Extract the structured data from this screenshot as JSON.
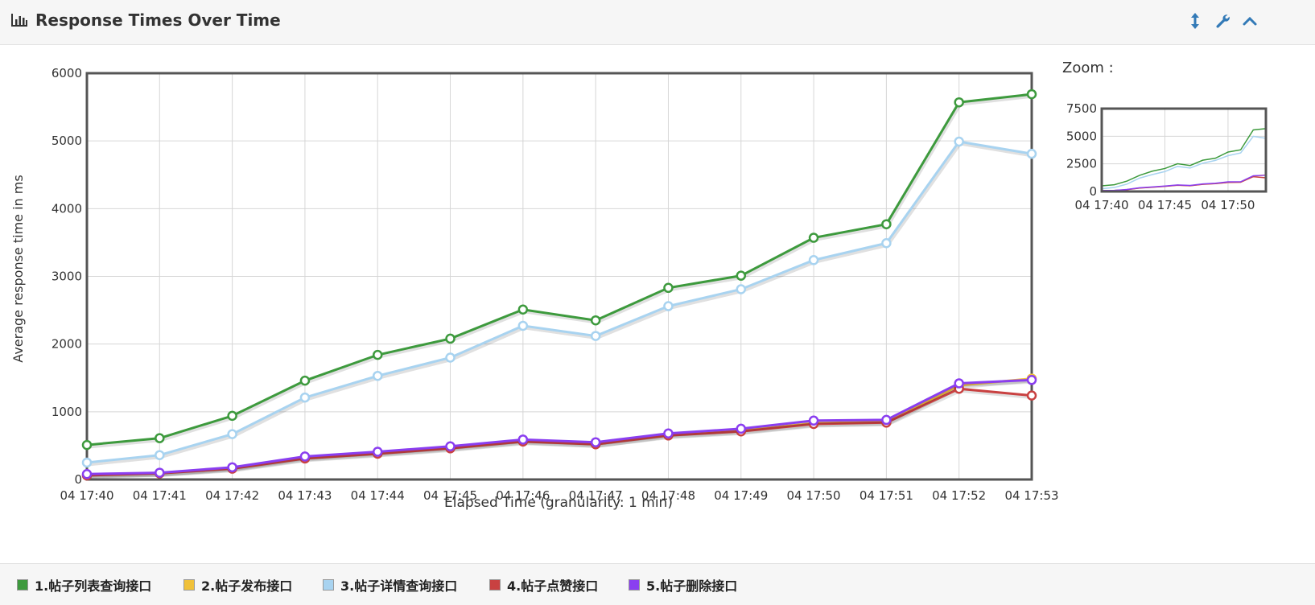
{
  "header": {
    "title": "Response Times Over Time",
    "icons": [
      "bar-chart-icon",
      "resize-vertical-icon",
      "wrench-icon",
      "chevron-up-icon"
    ],
    "accent_color": "#337ab7"
  },
  "zoom": {
    "label": "Zoom :"
  },
  "chart_data": {
    "type": "line",
    "title": "",
    "xlabel": "Elapsed Time (granularity: 1 min)",
    "ylabel": "Average response time in ms",
    "ylim": [
      0,
      6000
    ],
    "yticks": [
      0,
      1000,
      2000,
      3000,
      4000,
      5000,
      6000
    ],
    "grid": true,
    "legend_placement": "bottom",
    "x": [
      "04 17:40",
      "04 17:41",
      "04 17:42",
      "04 17:43",
      "04 17:44",
      "04 17:45",
      "04 17:46",
      "04 17:47",
      "04 17:48",
      "04 17:49",
      "04 17:50",
      "04 17:51",
      "04 17:52",
      "04 17:53"
    ],
    "series": [
      {
        "name": "1.帖子列表查询接口",
        "color": "#3d9a3d",
        "values": [
          510,
          610,
          940,
          1460,
          1840,
          2080,
          2510,
          2350,
          2830,
          3010,
          3570,
          3770,
          5570,
          5690
        ]
      },
      {
        "name": "2.帖子发布接口",
        "color": "#f0c13a",
        "values": [
          70,
          95,
          170,
          320,
          390,
          470,
          570,
          520,
          660,
          720,
          830,
          850,
          1390,
          1490
        ]
      },
      {
        "name": "3.帖子详情查询接口",
        "color": "#a8d3f0",
        "values": [
          250,
          360,
          670,
          1210,
          1530,
          1800,
          2270,
          2120,
          2560,
          2810,
          3240,
          3490,
          4990,
          4810
        ]
      },
      {
        "name": "4.帖子点赞接口",
        "color": "#c94141",
        "values": [
          60,
          90,
          160,
          310,
          380,
          460,
          560,
          520,
          650,
          710,
          820,
          840,
          1340,
          1240
        ]
      },
      {
        "name": "5.帖子删除接口",
        "color": "#8a3ef0",
        "values": [
          80,
          100,
          180,
          340,
          410,
          490,
          590,
          550,
          680,
          750,
          870,
          880,
          1420,
          1470
        ]
      }
    ],
    "zoom_chart": {
      "ylim": [
        0,
        7500
      ],
      "yticks": [
        0,
        2500,
        5000,
        7500
      ],
      "xticks": [
        "04 17:40",
        "04 17:45",
        "04 17:50"
      ]
    }
  }
}
